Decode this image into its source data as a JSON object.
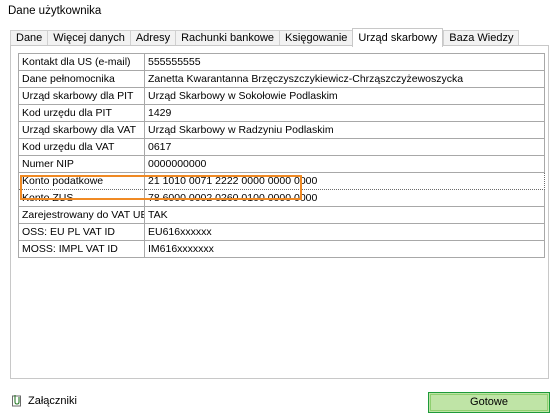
{
  "window": {
    "title": "Dane użytkownika"
  },
  "tabs": [
    {
      "label": "Dane",
      "active": false
    },
    {
      "label": "Więcej danych",
      "active": false
    },
    {
      "label": "Adresy",
      "active": false
    },
    {
      "label": "Rachunki bankowe",
      "active": false
    },
    {
      "label": "Księgowanie",
      "active": false
    },
    {
      "label": "Urząd skarbowy",
      "active": true
    },
    {
      "label": "Baza Wiedzy",
      "active": false
    }
  ],
  "fields": [
    {
      "label": "Kontakt dla US (e-mail)",
      "value": "555555555"
    },
    {
      "label": "Dane pełnomocnika",
      "value": "Zanetta Kwarantanna Brzęczyszczykiewicz-Chrząszczyżewoszycka"
    },
    {
      "label": "Urząd skarbowy dla PIT",
      "value": "Urząd Skarbowy w Sokołowie Podlaskim"
    },
    {
      "label": "Kod urzędu dla PIT",
      "value": "1429"
    },
    {
      "label": "Urząd skarbowy dla VAT",
      "value": "Urząd Skarbowy w Radzyniu Podlaskim"
    },
    {
      "label": "Kod urzędu dla VAT",
      "value": "0617"
    },
    {
      "label": "Numer NIP",
      "value": "0000000000"
    },
    {
      "label": "Konto podatkowe",
      "value": "21 1010 0071 2222 0000 0000 0000",
      "selected": true
    },
    {
      "label": "Konto ZUS",
      "value": "78 6000 0002 0260 0100 0000 0000"
    },
    {
      "label": "Zarejestrowany do VAT UE",
      "value": "TAK"
    },
    {
      "label": "OSS: EU PL VAT ID",
      "value": "EU616xxxxxx"
    },
    {
      "label": "MOSS: IMPL VAT ID",
      "value": "IM616xxxxxxx"
    }
  ],
  "footer": {
    "attachments_label": "Załączniki",
    "attachments_icon": "paperclip-icon",
    "done_label": "Gotowe"
  },
  "colors": {
    "highlight": "#f08a24",
    "done_button_bg": "#bfe4a6",
    "done_button_border": "#1e9a3a"
  }
}
